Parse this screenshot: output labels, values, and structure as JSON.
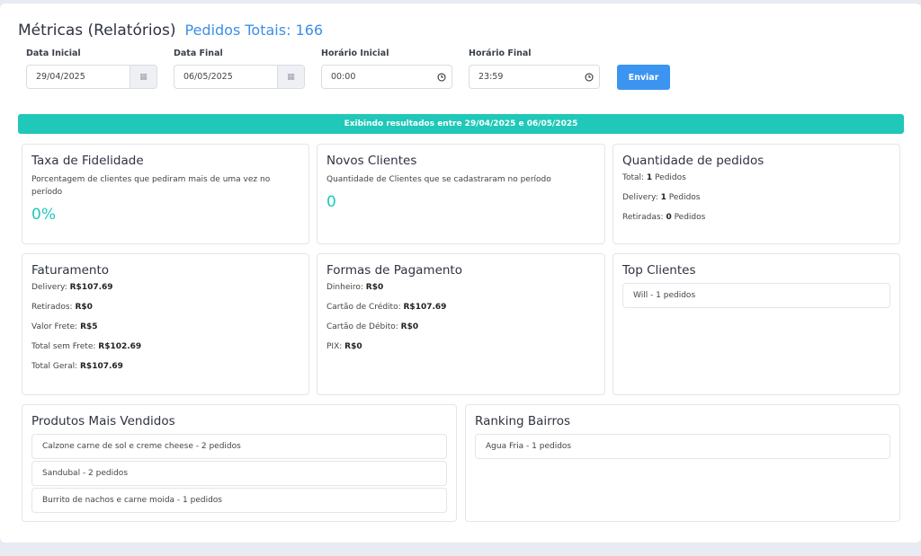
{
  "header": {
    "title": "Métricas (Relatórios)",
    "total": "Pedidos Totais: 166"
  },
  "filters": {
    "data_inicial": {
      "label": "Data Inicial",
      "value": "29/04/2025"
    },
    "data_final": {
      "label": "Data Final",
      "value": "06/05/2025"
    },
    "horario_inicial": {
      "label": "Horário Inicial",
      "value": "00:00"
    },
    "horario_final": {
      "label": "Horário Final",
      "value": "23:59"
    },
    "submit_label": "Enviar"
  },
  "banner": "Exibindo resultados entre 29/04/2025 e 06/05/2025",
  "fidelidade": {
    "title": "Taxa de Fidelidade",
    "desc": "Porcentagem de clientes que pediram mais de uma vez no período",
    "value": "0%"
  },
  "novos_clientes": {
    "title": "Novos Clientes",
    "desc": "Quantidade de Clientes que se cadastraram no período",
    "value": "0"
  },
  "quantidade": {
    "title": "Quantidade de pedidos",
    "lines": [
      {
        "label": "Total: ",
        "value": "1",
        "suffix": " Pedidos"
      },
      {
        "label": "Delivery: ",
        "value": "1",
        "suffix": " Pedidos"
      },
      {
        "label": "Retiradas: ",
        "value": "0",
        "suffix": " Pedidos"
      }
    ]
  },
  "faturamento": {
    "title": "Faturamento",
    "lines": [
      {
        "label": "Delivery: ",
        "value": "R$107.69"
      },
      {
        "label": "Retirados: ",
        "value": "R$0"
      },
      {
        "label": "Valor Frete: ",
        "value": "R$5"
      },
      {
        "label": "Total sem Frete: ",
        "value": "R$102.69"
      },
      {
        "label": "Total Geral: ",
        "value": "R$107.69"
      }
    ]
  },
  "pagamento": {
    "title": "Formas de Pagamento",
    "lines": [
      {
        "label": "Dinheiro: ",
        "value": "R$0"
      },
      {
        "label": "Cartão de Crédito: ",
        "value": "R$107.69"
      },
      {
        "label": "Cartão de Débito: ",
        "value": "R$0"
      },
      {
        "label": "PIX: ",
        "value": "R$0"
      }
    ]
  },
  "top_clientes": {
    "title": "Top Clientes",
    "items": [
      "Will - 1 pedidos"
    ]
  },
  "produtos": {
    "title": "Produtos Mais Vendidos",
    "items": [
      "Calzone carne de sol e creme cheese - 2 pedidos",
      "Sandubal - 2 pedidos",
      "Burrito de nachos e carne moida - 1 pedidos"
    ]
  },
  "bairros": {
    "title": "Ranking Bairros",
    "items": [
      "Agua Fria - 1 pedidos"
    ]
  }
}
